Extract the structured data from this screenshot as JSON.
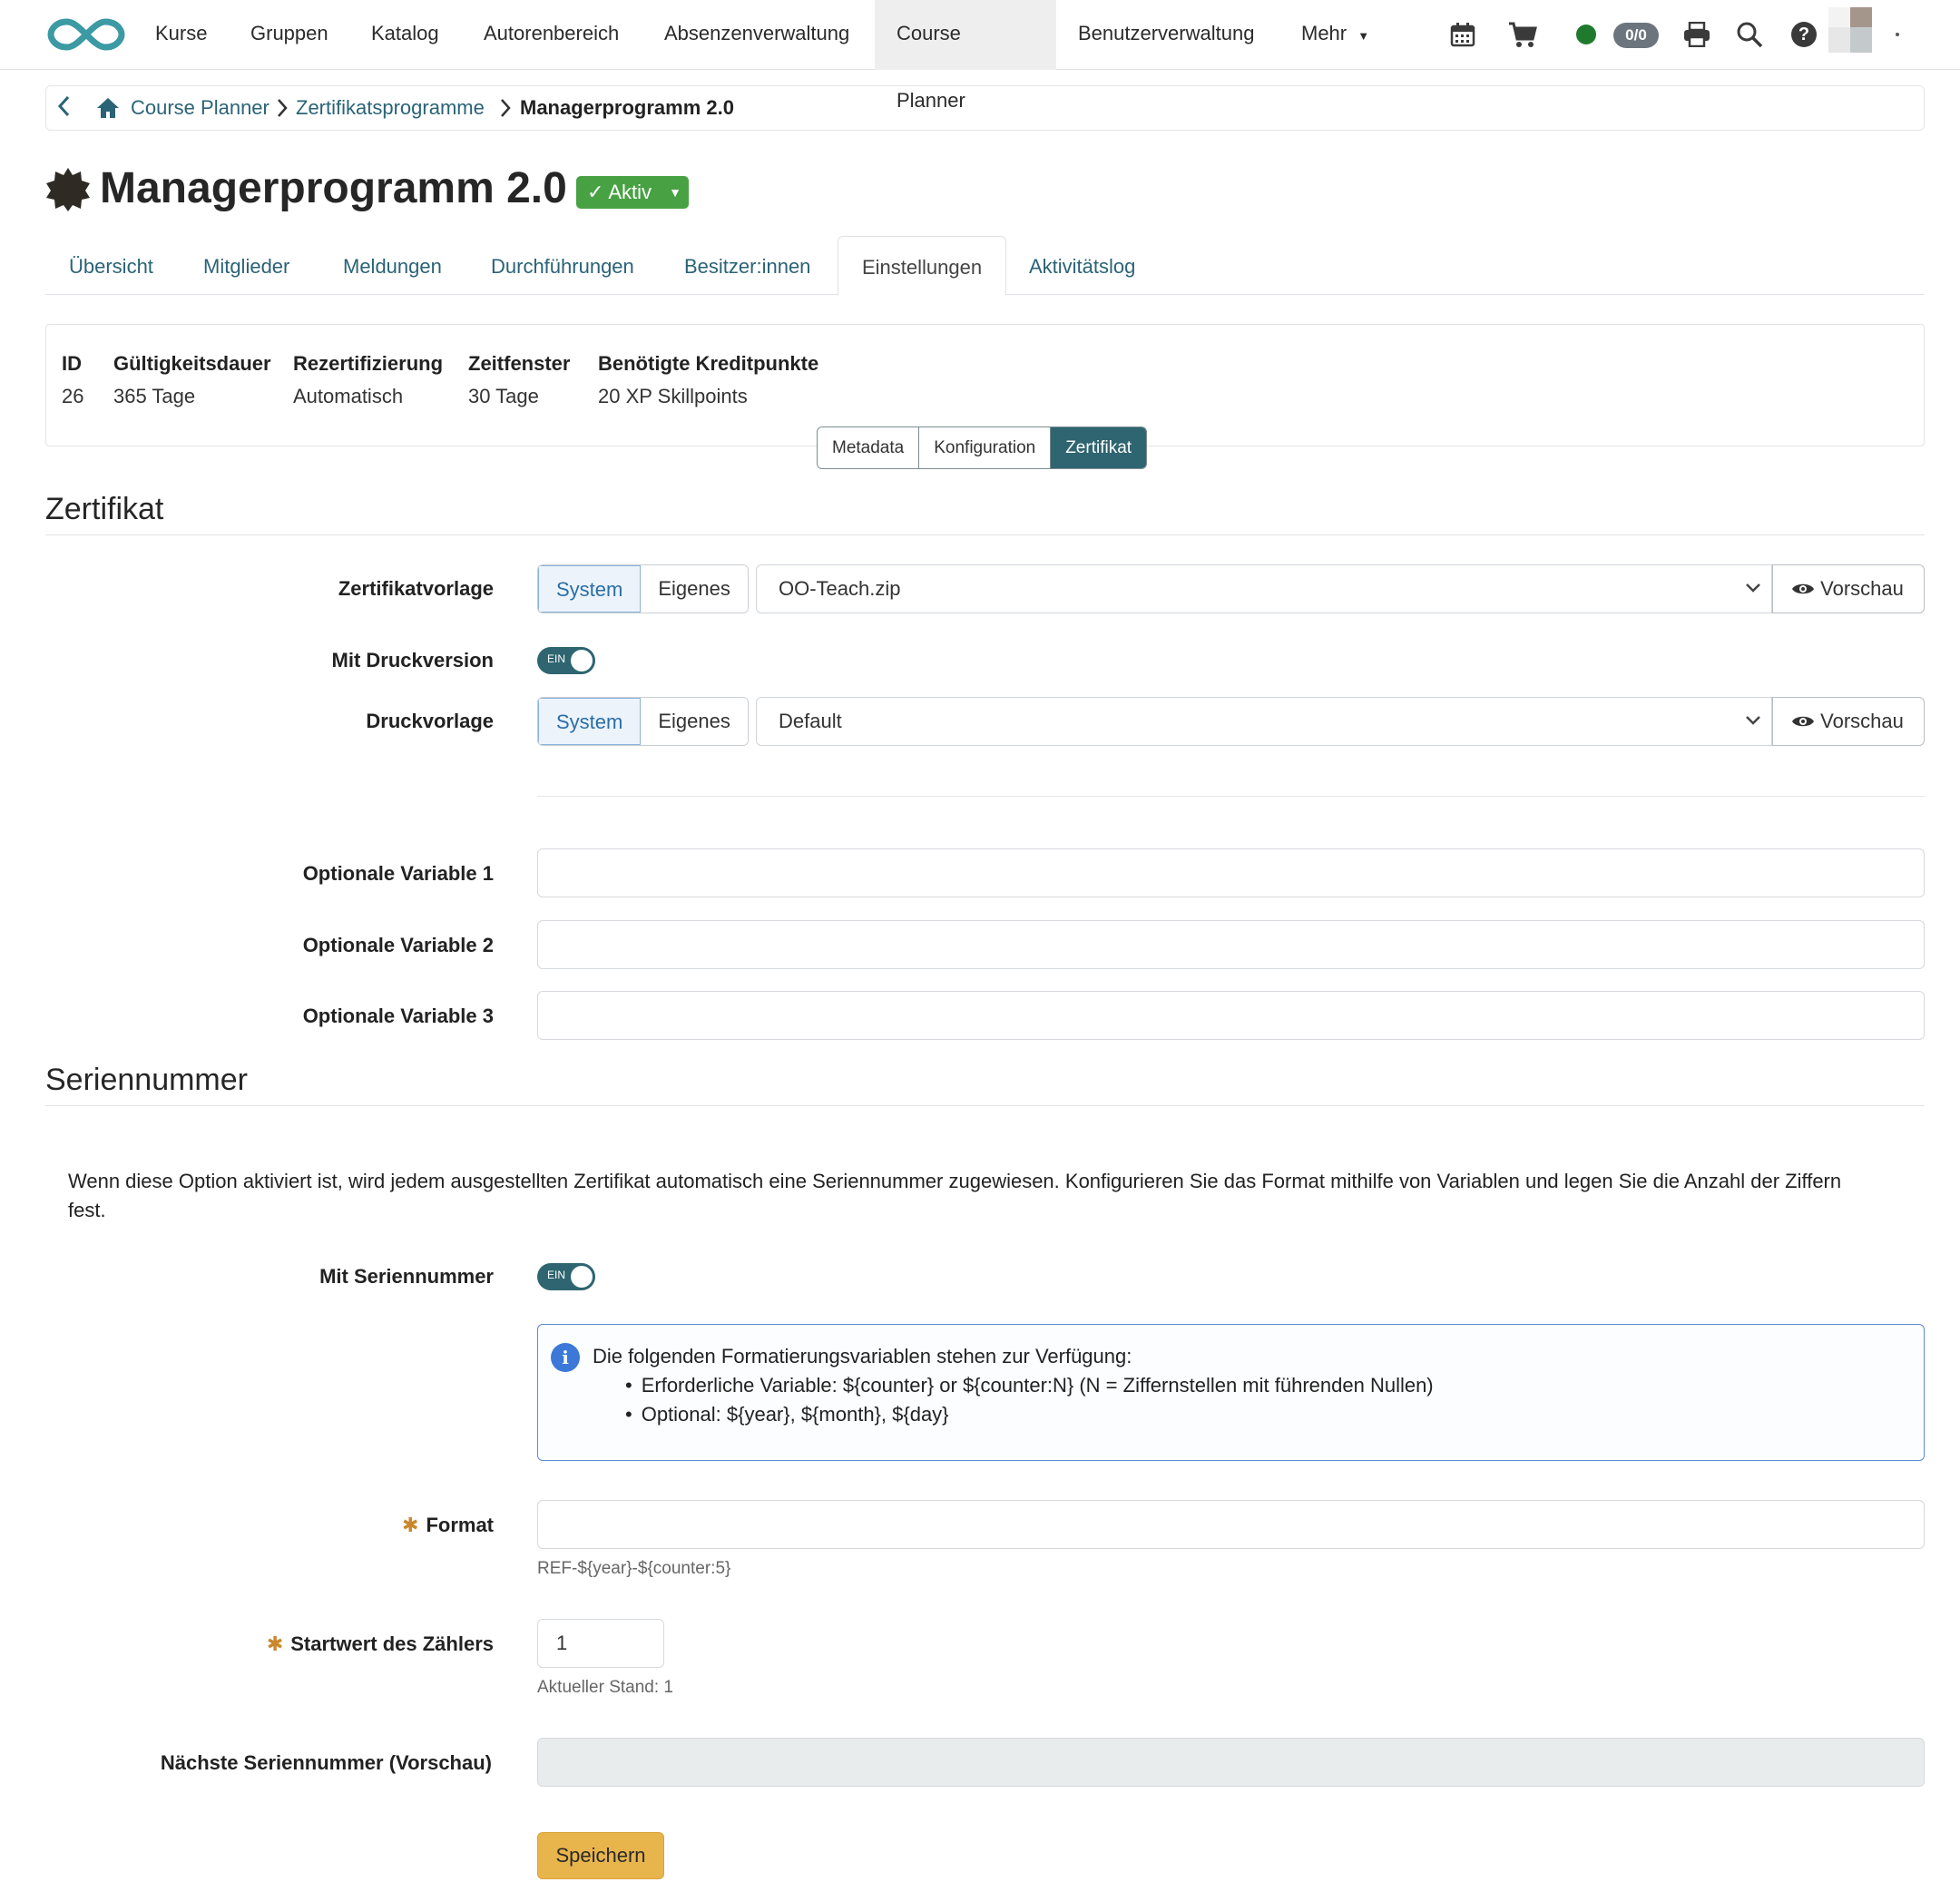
{
  "nav": {
    "items": [
      {
        "label": "Kurse"
      },
      {
        "label": "Gruppen"
      },
      {
        "label": "Katalog"
      },
      {
        "label": "Autorenbereich"
      },
      {
        "label": "Absenzenverwaltung"
      },
      {
        "label": "Course Planner"
      },
      {
        "label": "Benutzerverwaltung"
      },
      {
        "label": "Mehr"
      }
    ],
    "active": "Course Planner",
    "counter": "0/0",
    "colors": {
      "logo": "#3b9aa3",
      "status_dot": "#1f7a2e"
    }
  },
  "breadcrumb": {
    "items": [
      "Course Planner",
      "Zertifikatsprogramme"
    ],
    "current": "Managerprogramm 2.0"
  },
  "header": {
    "title": "Managerprogramm 2.0",
    "status": "Aktiv",
    "status_color": "#48a243"
  },
  "tabs": [
    {
      "label": "Übersicht"
    },
    {
      "label": "Mitglieder"
    },
    {
      "label": "Meldungen"
    },
    {
      "label": "Durchführungen"
    },
    {
      "label": "Besitzer:innen"
    },
    {
      "label": "Einstellungen"
    },
    {
      "label": "Aktivitätslog"
    }
  ],
  "info": {
    "id_label": "ID",
    "id_value": "26",
    "validity_label": "Gültigkeitsdauer",
    "validity_value": "365 Tage",
    "recert_label": "Rezertifizierung",
    "recert_value": "Automatisch",
    "window_label": "Zeitfenster",
    "window_value": "30 Tage",
    "credits_label": "Benötigte Kreditpunkte",
    "credits_value": "20 XP Skillpoints"
  },
  "subtabs": [
    "Metadata",
    "Konfiguration",
    "Zertifikat"
  ],
  "certificate": {
    "section_title": "Zertifikat",
    "template_label": "Zertifikatvorlage",
    "system_label": "System",
    "custom_label": "Eigenes",
    "template_value": "OO-Teach.zip",
    "preview_label": "Vorschau",
    "print_label": "Mit Druckversion",
    "toggle_on": "EIN",
    "print_template_label": "Druckvorlage",
    "print_template_value": "Default",
    "var1_label": "Optionale Variable 1",
    "var2_label": "Optionale Variable 2",
    "var3_label": "Optionale Variable 3"
  },
  "serial": {
    "section_title": "Seriennummer",
    "description_1": "Wenn diese Option aktiviert ist, wird jedem ausgestellten Zertifikat automatisch eine Seriennummer zugewiesen. Konfigurieren Sie das Format mithilfe von Variablen und legen Sie die Anzahl der Ziffern",
    "description_2": "fest.",
    "with_serial_label": "Mit Seriennummer",
    "info_intro": "Die folgenden Formatierungsvariablen stehen zur Verfügung:",
    "info_required": "Erforderliche Variable: ${counter} or ${counter:N} (N = Ziffernstellen mit führenden Nullen)",
    "info_optional": "Optional: ${year}, ${month}, ${day}",
    "format_label": "Format",
    "format_value": "",
    "format_help": "REF-${year}-${counter:5}",
    "counter_label": "Startwert des Zählers",
    "counter_value": "1",
    "counter_help": "Aktueller Stand: 1",
    "next_label": "Nächste Seriennummer (Vorschau)",
    "next_value": ""
  },
  "actions": {
    "save_label": "Speichern",
    "save_color": "#e8b44c"
  }
}
